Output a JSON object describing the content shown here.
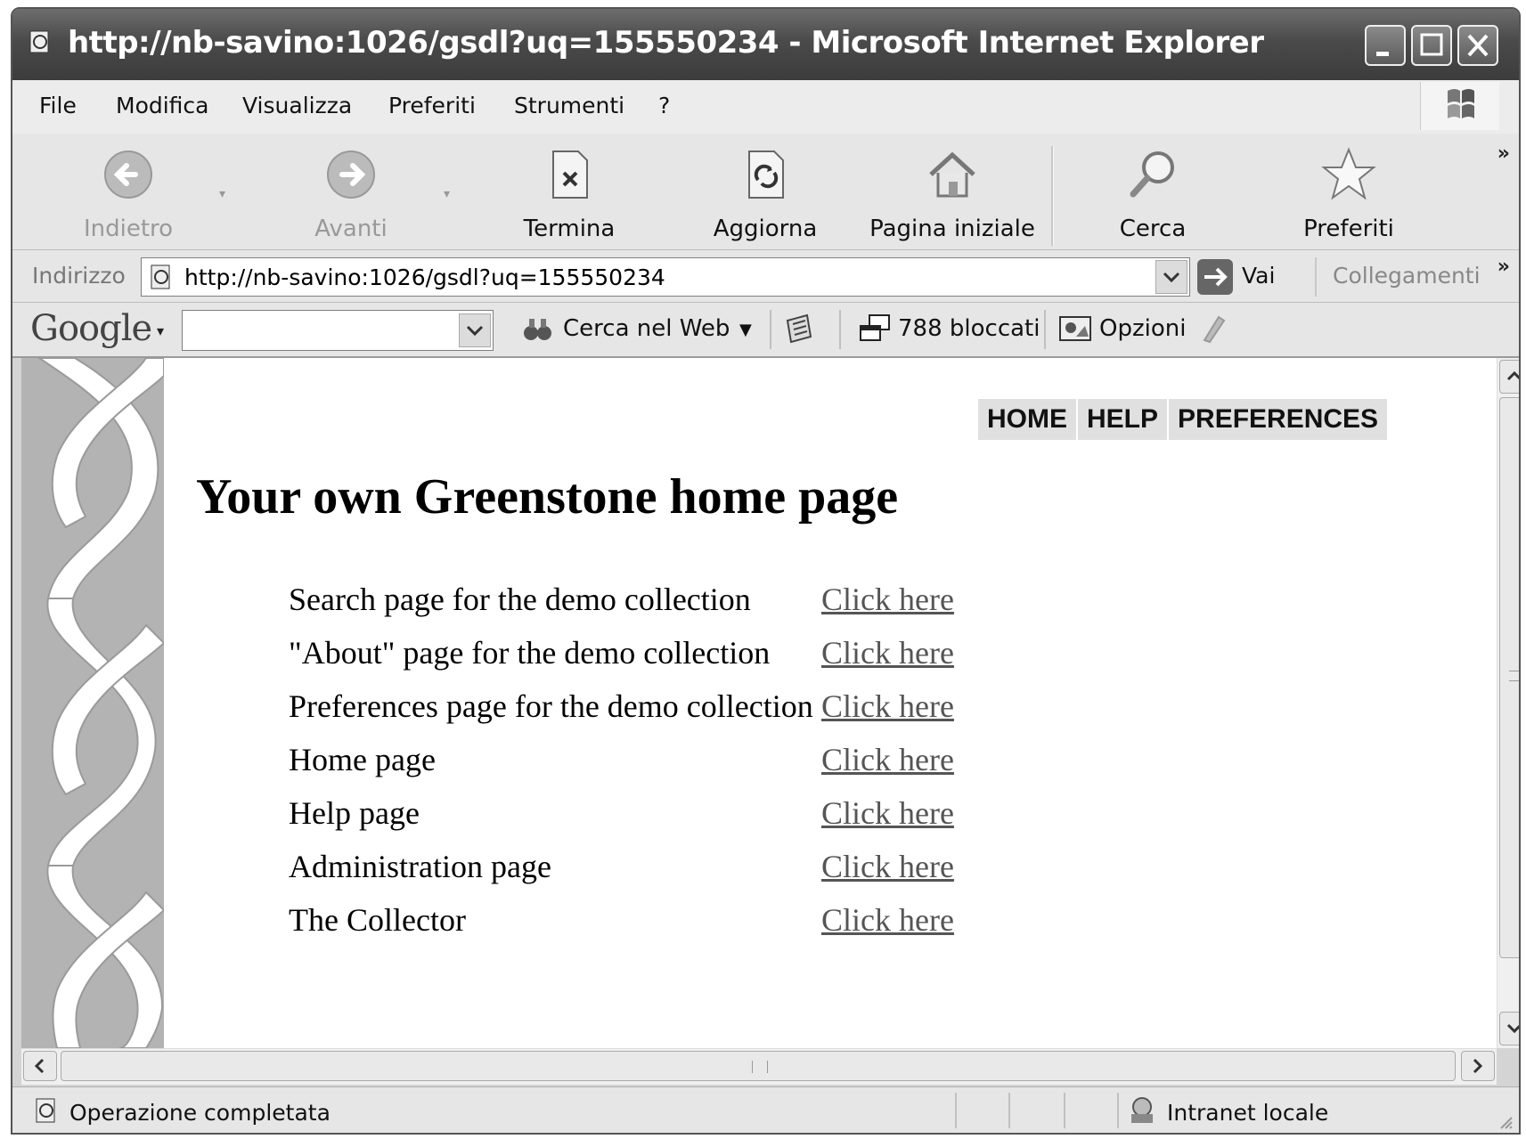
{
  "window": {
    "title": "http://nb-savino:1026/gsdl?uq=155550234 - Microsoft Internet Explorer"
  },
  "menu": [
    "File",
    "Modifica",
    "Visualizza",
    "Preferiti",
    "Strumenti",
    "?"
  ],
  "toolbar": {
    "back": "Indietro",
    "forward": "Avanti",
    "stop": "Termina",
    "refresh": "Aggiorna",
    "home": "Pagina iniziale",
    "search": "Cerca",
    "favorites": "Preferiti",
    "more": "»"
  },
  "address": {
    "label": "Indirizzo",
    "url": "http://nb-savino:1026/gsdl?uq=155550234",
    "go": "Vai",
    "links": "Collegamenti",
    "more": "»"
  },
  "google": {
    "logo": "Google",
    "search_value": "",
    "search_web": "Cerca nel Web",
    "blocked": "788 bloccati",
    "options": "Opzioni"
  },
  "page": {
    "nav": [
      "HOME",
      "HELP",
      "PREFERENCES"
    ],
    "heading": "Your own Greenstone home page",
    "rows": [
      {
        "description": "Search page for the demo collection",
        "link": "Click here"
      },
      {
        "description": "\"About\" page for the demo collection",
        "link": "Click here"
      },
      {
        "description": "Preferences page for the demo collection",
        "link": "Click here"
      },
      {
        "description": "Home page",
        "link": "Click here"
      },
      {
        "description": "Help page",
        "link": "Click here"
      },
      {
        "description": "Administration page",
        "link": "Click here"
      },
      {
        "description": "The Collector",
        "link": "Click here"
      }
    ]
  },
  "status": {
    "text": "Operazione completata",
    "zone": "Intranet locale"
  },
  "icons": {
    "title": "ie-page-icon",
    "back": "back-arrow-icon",
    "forward": "forward-arrow-icon",
    "stop": "stop-icon",
    "refresh": "refresh-icon",
    "home": "home-icon",
    "search": "magnifier-icon",
    "favorites": "star-icon"
  }
}
